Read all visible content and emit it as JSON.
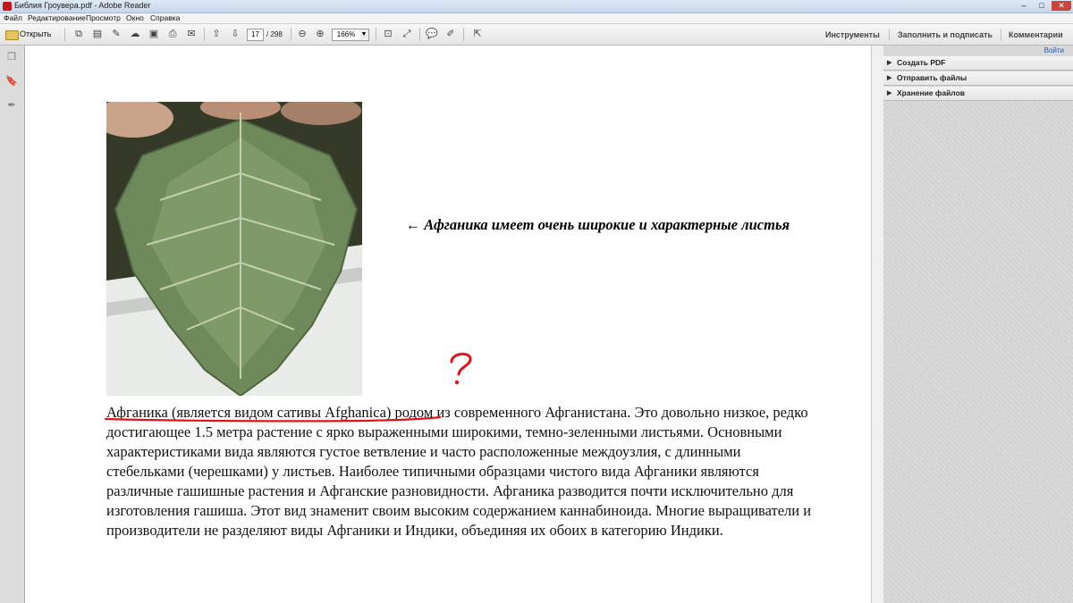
{
  "window": {
    "title": "Библия Гроувера.pdf - Adobe Reader",
    "controls": {
      "minimize": "–",
      "maximize": "□",
      "close": "✕"
    }
  },
  "menu": [
    "Файл",
    "Редактирование",
    "Просмотр",
    "Окно",
    "Справка"
  ],
  "toolbar": {
    "open_label": "Открыть",
    "page_current": "17",
    "page_total": "/ 298",
    "zoom": "166%",
    "right_tabs": [
      "Инструменты",
      "Заполнить и подписать",
      "Комментарии"
    ]
  },
  "document": {
    "caption": "← Афганика имеет очень широкие и характерные листья",
    "annotation_mark": "?",
    "body": "Афганика (является видом сативы Afghanica) родом из современного Афганистана. Это довольно низкое, редко достигающее 1.5 метра растение с ярко выраженными широкими, темно-зеленными листьями. Основными характеристиками вида являются густое ветвление и часто расположенные междоузлия, с длинными стебельками (черешками) у листьев. Наиболее типичными образцами чистого вида Афганики являются различные гашишные растения и Афганские разновидности. Афганика разводится почти исключительно для изготовления гашиша. Этот вид знаменит своим высоким содержанием каннабиноида. Многие выращиватели и производители не разделяют виды Афганики и Индики, объединяя их обоих в категорию Индики."
  },
  "right_panel": {
    "hide_label": "Войти",
    "sections": [
      "Создать PDF",
      "Отправить файлы",
      "Хранение файлов"
    ]
  },
  "colors": {
    "annotation_red": "#e0141e",
    "link_blue": "#1f5da8"
  }
}
